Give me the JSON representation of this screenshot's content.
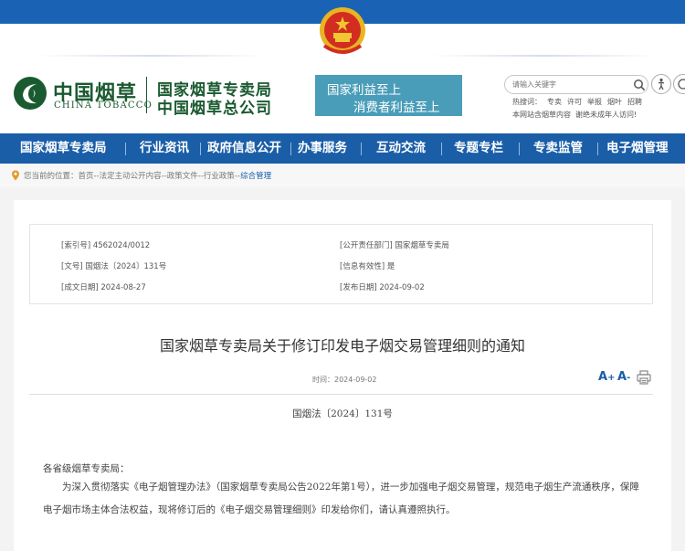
{
  "header": {
    "logo_cn": "中国烟草",
    "logo_en": "CHINA TOBACCO",
    "org_line1": "国家烟草专卖局",
    "org_line2": "中国烟草总公司",
    "slogan_line1": "国家利益至上",
    "slogan_line2": "消费者利益至上",
    "search_placeholder": "请输入关键字",
    "hot_words": [
      "热搜词：",
      "专卖",
      "许可",
      "举报",
      "烟叶",
      "招聘"
    ],
    "notice": [
      "本网站含烟草内容",
      "谢绝未成年人访问!"
    ]
  },
  "nav": {
    "items": [
      "国家烟草专卖局",
      "行业资讯",
      "政府信息公开",
      "办事服务",
      "互动交流",
      "专题专栏",
      "专卖监管",
      "电子烟管理"
    ]
  },
  "breadcrumb": {
    "label": "您当前的位置：",
    "path": "首页--法定主动公开内容--政策文件--行业政策--",
    "current": "综合管理"
  },
  "meta": {
    "index_no": "[索引号] 4562024/0012",
    "dept": "[公开责任部门] 国家烟草专卖局",
    "doc_no": "[文号] 国烟法〔2024〕131号",
    "validity": "[信息有效性] 是",
    "written_date": "[成文日期] 2024-08-27",
    "publish_date": "[发布日期] 2024-09-02"
  },
  "article": {
    "title": "国家烟草专卖局关于修订印发电子烟交易管理细则的通知",
    "time": "时间：2024-09-02",
    "font_large": "A",
    "font_small": "A",
    "doc_number": "国烟法〔2024〕131号",
    "salutation": "各省级烟草专卖局：",
    "paragraph": "为深入贯彻落实《电子烟管理办法》（国家烟草专卖局公告2022年第1号），进一步加强电子烟交易管理，规范电子烟生产流通秩序，保障电子烟市场主体合法权益，现将修订后的《电子烟交易管理细则》印发给你们，请认真遵照执行。"
  },
  "colors": {
    "primary_blue": "#1b5ea8",
    "brand_green": "#1a5a30",
    "slogan_bg": "#4a9db8"
  }
}
